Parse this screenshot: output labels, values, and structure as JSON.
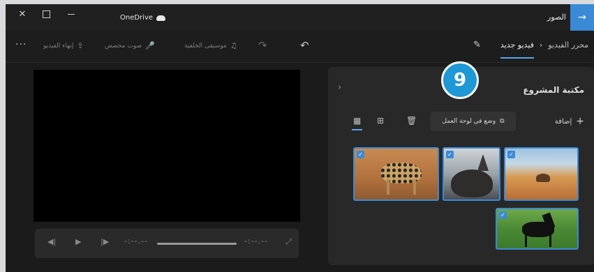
{
  "titlebar": {
    "app_name": "الصور",
    "back_label": "→",
    "cloud_label": "OneDrive",
    "close_glyph": "✕"
  },
  "toolbar": {
    "breadcrumb_root": "محرر الفيديو",
    "breadcrumb_sep": "›",
    "breadcrumb_current": "فيديو جديد",
    "edit_glyph": "✎",
    "undo_glyph": "↶",
    "redo_glyph": "↷",
    "background_music": "موسيقى الخلفية",
    "custom_audio": "صوت مخصص",
    "finish_video": "إنهاء الفيديو",
    "more_glyph": "···"
  },
  "player": {
    "prev_glyph": "◀|",
    "play_glyph": "▶",
    "next_glyph": "|▶",
    "current_time": "-:--.--",
    "total_time": "-:--.--",
    "fullscreen_glyph": "⤢",
    "progress": 0
  },
  "library": {
    "title": "مكتبة المشروع",
    "collapse_glyph": "›",
    "add_label": "إضافة",
    "place_in_storyboard": "وضع في لوحة العمل",
    "items": [
      {
        "name": "cheetah",
        "selected": true
      },
      {
        "name": "cat",
        "selected": true
      },
      {
        "name": "camel",
        "selected": true
      },
      {
        "name": "horse",
        "selected": true
      }
    ]
  },
  "callout": {
    "number": "9"
  },
  "colors": {
    "accent": "#3b8ad6",
    "badge": "#1f98d6",
    "window_bg": "#1f1f1f",
    "panel_bg": "#282828"
  }
}
